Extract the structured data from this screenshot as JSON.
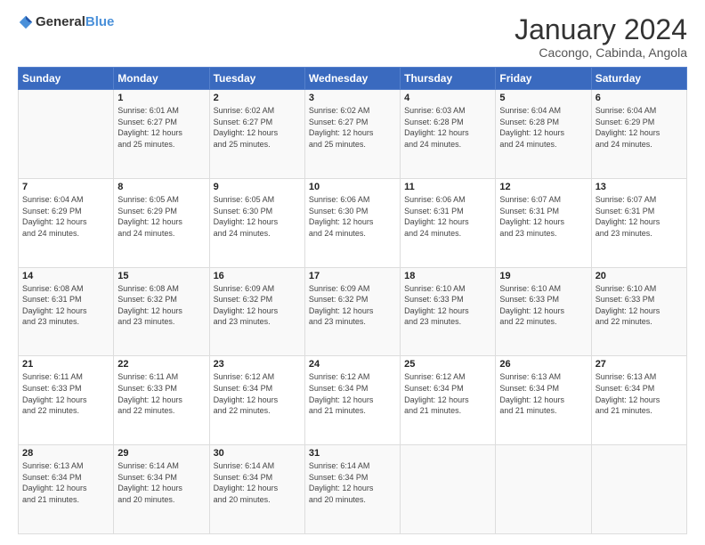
{
  "logo": {
    "text_general": "General",
    "text_blue": "Blue"
  },
  "title": {
    "month_year": "January 2024",
    "location": "Cacongo, Cabinda, Angola"
  },
  "days_header": [
    "Sunday",
    "Monday",
    "Tuesday",
    "Wednesday",
    "Thursday",
    "Friday",
    "Saturday"
  ],
  "weeks": [
    [
      {
        "day": "",
        "content": ""
      },
      {
        "day": "1",
        "content": "Sunrise: 6:01 AM\nSunset: 6:27 PM\nDaylight: 12 hours\nand 25 minutes."
      },
      {
        "day": "2",
        "content": "Sunrise: 6:02 AM\nSunset: 6:27 PM\nDaylight: 12 hours\nand 25 minutes."
      },
      {
        "day": "3",
        "content": "Sunrise: 6:02 AM\nSunset: 6:27 PM\nDaylight: 12 hours\nand 25 minutes."
      },
      {
        "day": "4",
        "content": "Sunrise: 6:03 AM\nSunset: 6:28 PM\nDaylight: 12 hours\nand 24 minutes."
      },
      {
        "day": "5",
        "content": "Sunrise: 6:04 AM\nSunset: 6:28 PM\nDaylight: 12 hours\nand 24 minutes."
      },
      {
        "day": "6",
        "content": "Sunrise: 6:04 AM\nSunset: 6:29 PM\nDaylight: 12 hours\nand 24 minutes."
      }
    ],
    [
      {
        "day": "7",
        "content": "Sunrise: 6:04 AM\nSunset: 6:29 PM\nDaylight: 12 hours\nand 24 minutes."
      },
      {
        "day": "8",
        "content": "Sunrise: 6:05 AM\nSunset: 6:29 PM\nDaylight: 12 hours\nand 24 minutes."
      },
      {
        "day": "9",
        "content": "Sunrise: 6:05 AM\nSunset: 6:30 PM\nDaylight: 12 hours\nand 24 minutes."
      },
      {
        "day": "10",
        "content": "Sunrise: 6:06 AM\nSunset: 6:30 PM\nDaylight: 12 hours\nand 24 minutes."
      },
      {
        "day": "11",
        "content": "Sunrise: 6:06 AM\nSunset: 6:31 PM\nDaylight: 12 hours\nand 24 minutes."
      },
      {
        "day": "12",
        "content": "Sunrise: 6:07 AM\nSunset: 6:31 PM\nDaylight: 12 hours\nand 23 minutes."
      },
      {
        "day": "13",
        "content": "Sunrise: 6:07 AM\nSunset: 6:31 PM\nDaylight: 12 hours\nand 23 minutes."
      }
    ],
    [
      {
        "day": "14",
        "content": "Sunrise: 6:08 AM\nSunset: 6:31 PM\nDaylight: 12 hours\nand 23 minutes."
      },
      {
        "day": "15",
        "content": "Sunrise: 6:08 AM\nSunset: 6:32 PM\nDaylight: 12 hours\nand 23 minutes."
      },
      {
        "day": "16",
        "content": "Sunrise: 6:09 AM\nSunset: 6:32 PM\nDaylight: 12 hours\nand 23 minutes."
      },
      {
        "day": "17",
        "content": "Sunrise: 6:09 AM\nSunset: 6:32 PM\nDaylight: 12 hours\nand 23 minutes."
      },
      {
        "day": "18",
        "content": "Sunrise: 6:10 AM\nSunset: 6:33 PM\nDaylight: 12 hours\nand 23 minutes."
      },
      {
        "day": "19",
        "content": "Sunrise: 6:10 AM\nSunset: 6:33 PM\nDaylight: 12 hours\nand 22 minutes."
      },
      {
        "day": "20",
        "content": "Sunrise: 6:10 AM\nSunset: 6:33 PM\nDaylight: 12 hours\nand 22 minutes."
      }
    ],
    [
      {
        "day": "21",
        "content": "Sunrise: 6:11 AM\nSunset: 6:33 PM\nDaylight: 12 hours\nand 22 minutes."
      },
      {
        "day": "22",
        "content": "Sunrise: 6:11 AM\nSunset: 6:33 PM\nDaylight: 12 hours\nand 22 minutes."
      },
      {
        "day": "23",
        "content": "Sunrise: 6:12 AM\nSunset: 6:34 PM\nDaylight: 12 hours\nand 22 minutes."
      },
      {
        "day": "24",
        "content": "Sunrise: 6:12 AM\nSunset: 6:34 PM\nDaylight: 12 hours\nand 21 minutes."
      },
      {
        "day": "25",
        "content": "Sunrise: 6:12 AM\nSunset: 6:34 PM\nDaylight: 12 hours\nand 21 minutes."
      },
      {
        "day": "26",
        "content": "Sunrise: 6:13 AM\nSunset: 6:34 PM\nDaylight: 12 hours\nand 21 minutes."
      },
      {
        "day": "27",
        "content": "Sunrise: 6:13 AM\nSunset: 6:34 PM\nDaylight: 12 hours\nand 21 minutes."
      }
    ],
    [
      {
        "day": "28",
        "content": "Sunrise: 6:13 AM\nSunset: 6:34 PM\nDaylight: 12 hours\nand 21 minutes."
      },
      {
        "day": "29",
        "content": "Sunrise: 6:14 AM\nSunset: 6:34 PM\nDaylight: 12 hours\nand 20 minutes."
      },
      {
        "day": "30",
        "content": "Sunrise: 6:14 AM\nSunset: 6:34 PM\nDaylight: 12 hours\nand 20 minutes."
      },
      {
        "day": "31",
        "content": "Sunrise: 6:14 AM\nSunset: 6:34 PM\nDaylight: 12 hours\nand 20 minutes."
      },
      {
        "day": "",
        "content": ""
      },
      {
        "day": "",
        "content": ""
      },
      {
        "day": "",
        "content": ""
      }
    ]
  ]
}
